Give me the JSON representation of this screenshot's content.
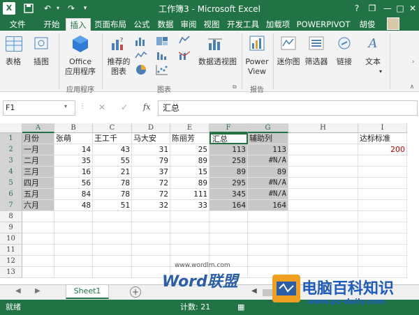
{
  "window": {
    "title": "工作簿3 - Microsoft Excel"
  },
  "qat": {
    "save_icon": "save-icon",
    "undo_icon": "undo-icon",
    "redo_icon": "redo-icon"
  },
  "window_buttons": {
    "help": "?",
    "restore": "❐",
    "minimize": "—",
    "maximize": "□",
    "close": "✕"
  },
  "tabs": [
    {
      "label": "文件"
    },
    {
      "label": "开始"
    },
    {
      "label": "插入"
    },
    {
      "label": "页面布局"
    },
    {
      "label": "公式"
    },
    {
      "label": "数据"
    },
    {
      "label": "审阅"
    },
    {
      "label": "视图"
    },
    {
      "label": "开发工具"
    },
    {
      "label": "加载项"
    },
    {
      "label": "POWERPIVOT"
    },
    {
      "label": "胡俊"
    }
  ],
  "active_tab": "插入",
  "ribbon": {
    "table": "表格",
    "illustrations": "插图",
    "apps_line1": "Office",
    "apps_line2": "应用程序",
    "apps_group": "应用程序",
    "recommended_line1": "推荐的",
    "recommended_line2": "图表",
    "pivotchart": "数据透视图",
    "charts_group": "图表",
    "powerview_line1": "Power",
    "powerview_line2": "View",
    "reports_group": "报告",
    "sparklines": "迷你图",
    "filter": "筛选器",
    "links": "链接",
    "text": "文本"
  },
  "formula_bar": {
    "name_box": "F1",
    "fx": "fx",
    "formula": "汇总"
  },
  "grid": {
    "columns": [
      "A",
      "B",
      "C",
      "D",
      "E",
      "F",
      "G",
      "H",
      "I"
    ],
    "rows": [
      "1",
      "2",
      "3",
      "4",
      "5",
      "6",
      "7",
      "8",
      "9",
      "10",
      "11",
      "12",
      "13"
    ],
    "row1": [
      "月份",
      "张萌",
      "王工千",
      "马大安",
      "陈丽芳",
      "汇总",
      "辅助列",
      "",
      "达标标准"
    ],
    "data": [
      [
        "一月",
        "14",
        "43",
        "31",
        "25",
        "113",
        "113",
        "",
        "200"
      ],
      [
        "二月",
        "35",
        "55",
        "79",
        "89",
        "258",
        "#N/A",
        "",
        ""
      ],
      [
        "三月",
        "16",
        "21",
        "37",
        "15",
        "89",
        "89",
        "",
        ""
      ],
      [
        "四月",
        "56",
        "78",
        "72",
        "89",
        "295",
        "#N/A",
        "",
        ""
      ],
      [
        "五月",
        "84",
        "78",
        "72",
        "111",
        "345",
        "#N/A",
        "",
        ""
      ],
      [
        "六月",
        "48",
        "51",
        "32",
        "33",
        "164",
        "164",
        "",
        ""
      ]
    ]
  },
  "sheets": {
    "active": "Sheet1",
    "add": "+"
  },
  "status": {
    "ready": "就绪",
    "count": "计数: 21"
  },
  "watermark": {
    "site": "www.wordlm.com",
    "word": "Word联盟",
    "brand": "电脑百科知识",
    "url": "www.pc-daily.com"
  },
  "colors": {
    "accent": "#217346",
    "highlight": "#c8c8c8",
    "red": "#c00000"
  }
}
